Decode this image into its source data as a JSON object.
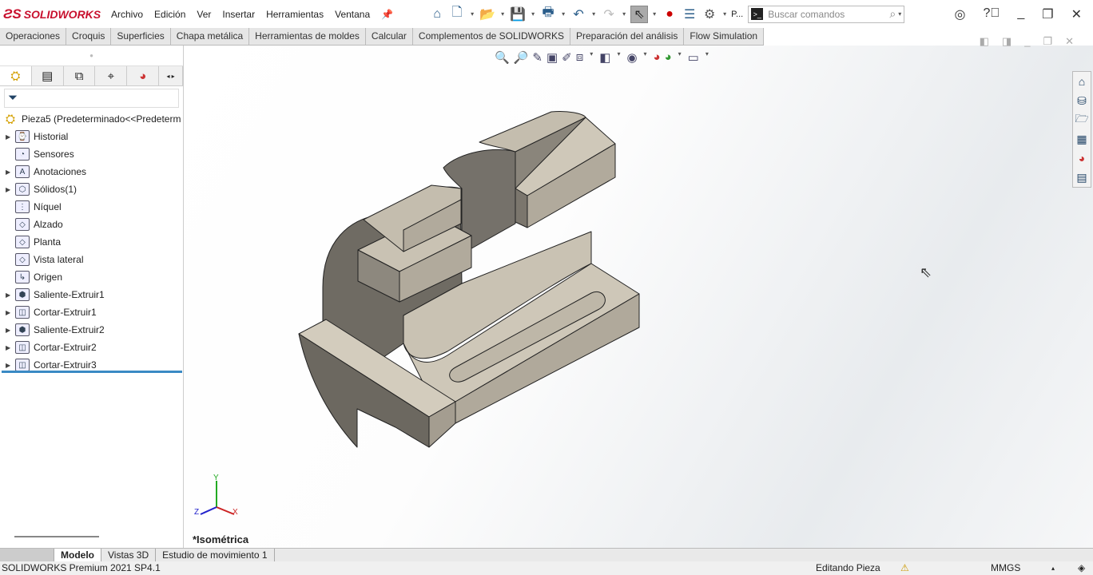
{
  "app": {
    "brand": "SOLIDWORKS",
    "brand_mark": "DS"
  },
  "menu": [
    "Archivo",
    "Edición",
    "Ver",
    "Insertar",
    "Herramientas",
    "Ventana"
  ],
  "toolbar": {
    "profile_label": "P...",
    "search_placeholder": "Buscar comandos"
  },
  "command_tabs": [
    "Operaciones",
    "Croquis",
    "Superficies",
    "Chapa metálica",
    "Herramientas de moldes",
    "Calcular",
    "Complementos de SOLIDWORKS",
    "Preparación del análisis",
    "Flow Simulation"
  ],
  "tree": {
    "root": "Pieza5  (Predeterminado<<Predeterm",
    "items": [
      {
        "label": "Historial",
        "expand": true
      },
      {
        "label": "Sensores",
        "expand": false
      },
      {
        "label": "Anotaciones",
        "expand": true
      },
      {
        "label": "Sólidos(1)",
        "expand": true
      },
      {
        "label": "Níquel",
        "expand": false
      },
      {
        "label": "Alzado",
        "expand": false
      },
      {
        "label": "Planta",
        "expand": false
      },
      {
        "label": "Vista lateral",
        "expand": false
      },
      {
        "label": "Origen",
        "expand": false
      },
      {
        "label": "Saliente-Extruir1",
        "expand": true
      },
      {
        "label": "Cortar-Extruir1",
        "expand": true
      },
      {
        "label": "Saliente-Extruir2",
        "expand": true
      },
      {
        "label": "Cortar-Extruir2",
        "expand": true
      },
      {
        "label": "Cortar-Extruir3",
        "expand": true
      }
    ]
  },
  "viewport": {
    "view_name": "*Isométrica",
    "axes": {
      "x": "X",
      "y": "Y",
      "z": "Z"
    }
  },
  "bottom_tabs": [
    "Modelo",
    "Vistas 3D",
    "Estudio de movimiento 1"
  ],
  "status": {
    "version": "SOLIDWORKS Premium 2021 SP4.1",
    "mode": "Editando Pieza",
    "units": "MMGS"
  }
}
